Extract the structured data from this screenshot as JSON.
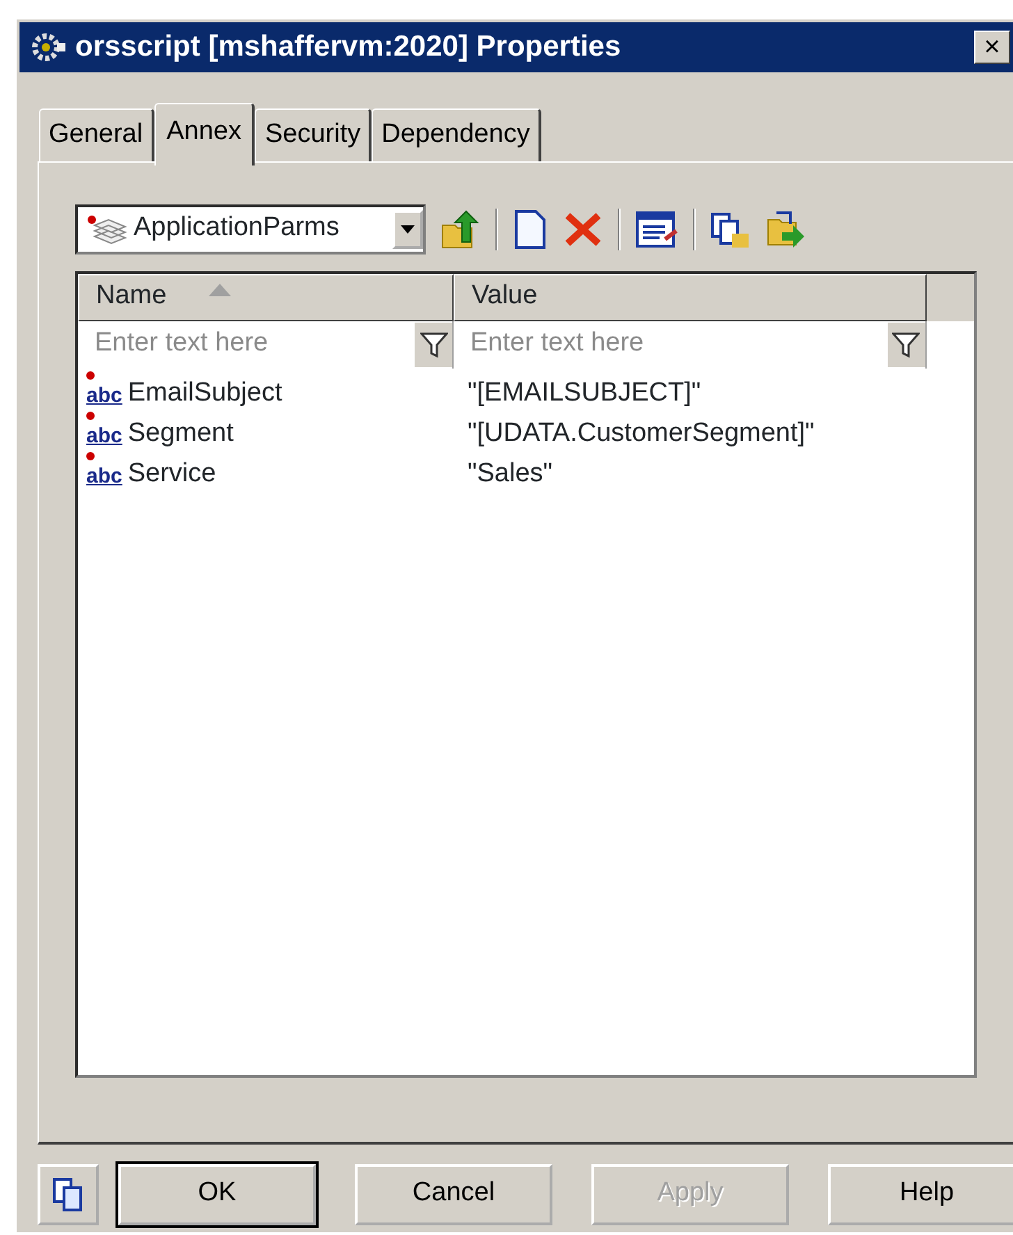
{
  "window": {
    "title": "orsscript [mshaffervm:2020] Properties",
    "close": "×"
  },
  "tabs": [
    {
      "label": "General",
      "selected": false
    },
    {
      "label": "Annex",
      "selected": true
    },
    {
      "label": "Security",
      "selected": false
    },
    {
      "label": "Dependency",
      "selected": false
    }
  ],
  "section_dropdown": {
    "value": "ApplicationParms"
  },
  "table": {
    "columns": [
      {
        "label": "Name",
        "sorted": true,
        "filter_placeholder": "Enter text here"
      },
      {
        "label": "Value",
        "sorted": false,
        "filter_placeholder": "Enter text here"
      }
    ],
    "rows": [
      {
        "type": "abc",
        "name": "EmailSubject",
        "value": "\"[EMAILSUBJECT]\""
      },
      {
        "type": "abc",
        "name": "Segment",
        "value": "\"[UDATA.CustomerSegment]\""
      },
      {
        "type": "abc",
        "name": "Service",
        "value": "\"Sales\""
      }
    ]
  },
  "buttons": [
    {
      "label": "OK",
      "default": true,
      "disabled": false
    },
    {
      "label": "Cancel",
      "default": false,
      "disabled": false
    },
    {
      "label": "Apply",
      "default": false,
      "disabled": true
    },
    {
      "label": "Help",
      "default": false,
      "disabled": false
    }
  ]
}
